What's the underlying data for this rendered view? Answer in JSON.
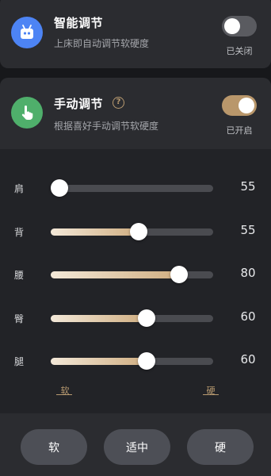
{
  "smart_mode": {
    "title": "智能调节",
    "subtitle": "上床即自动调节软硬度",
    "status": "已关闭",
    "enabled": false,
    "icon": "robot-icon",
    "icon_color": "#4d84f4"
  },
  "manual_mode": {
    "title": "手动调节",
    "help": "?",
    "subtitle": "根据喜好手动调节软硬度",
    "status": "已开启",
    "enabled": true,
    "icon": "hand-pointer-icon",
    "icon_color": "#4faf6b"
  },
  "sliders": [
    {
      "label": "肩",
      "value": "55",
      "fill_percent": 0
    },
    {
      "label": "背",
      "value": "55",
      "fill_percent": 55
    },
    {
      "label": "腰",
      "value": "80",
      "fill_percent": 80
    },
    {
      "label": "臀",
      "value": "60",
      "fill_percent": 60
    },
    {
      "label": "腿",
      "value": "60",
      "fill_percent": 60
    }
  ],
  "scale": {
    "soft": "软",
    "hard": "硬"
  },
  "presets": {
    "soft": "软",
    "medium": "适中",
    "hard": "硬"
  },
  "colors": {
    "accent": "#b9976b",
    "toggle_off": "#5a5b60"
  }
}
